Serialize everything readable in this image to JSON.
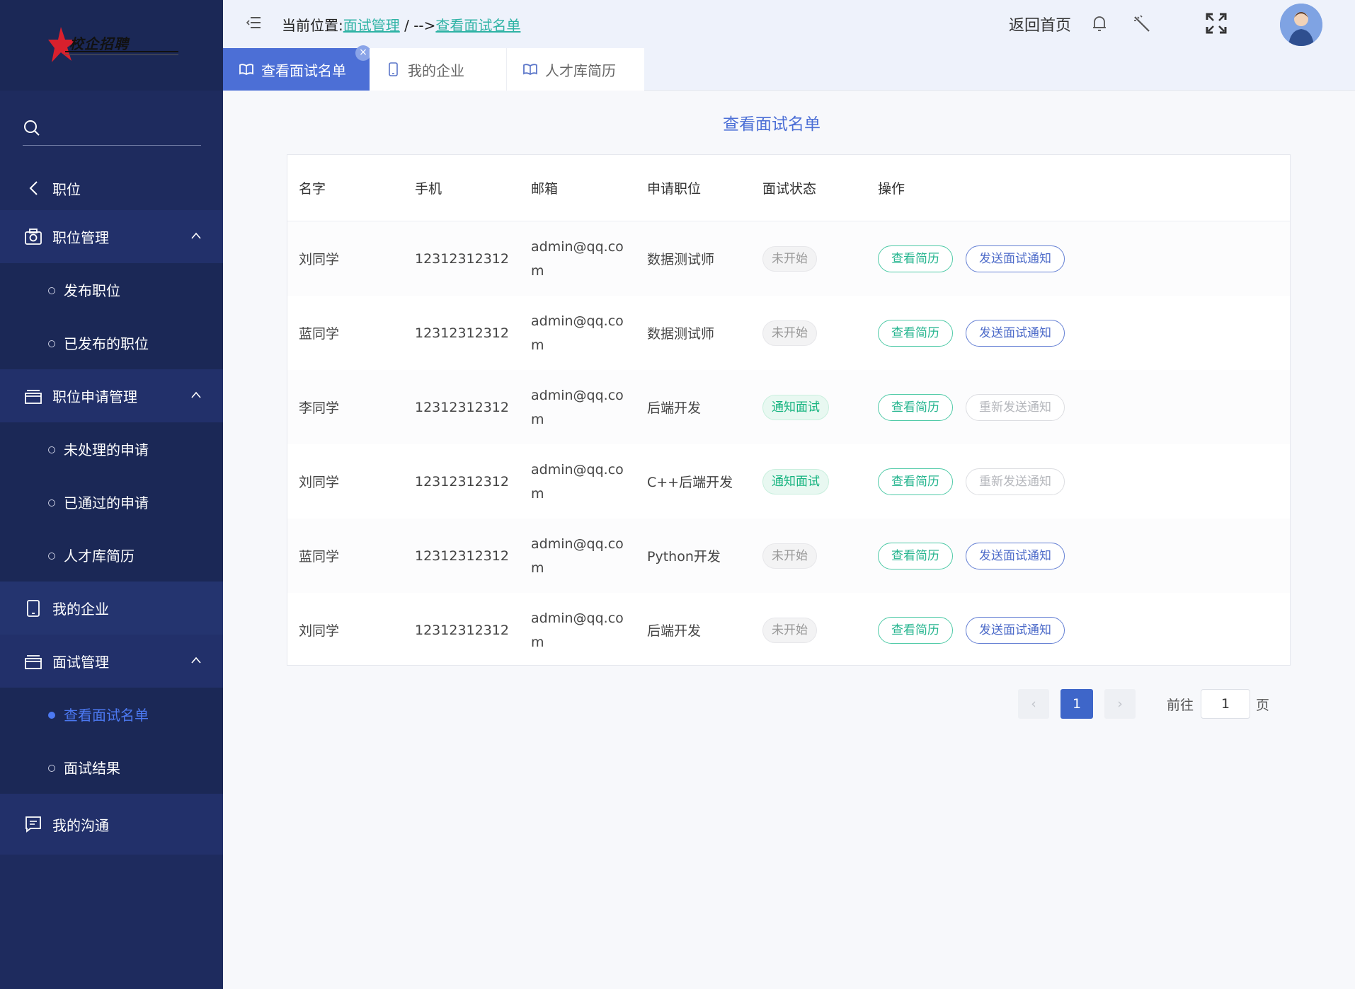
{
  "logo": {
    "text": "校企招聘"
  },
  "sidebar": {
    "search_placeholder": "",
    "back_label": "职位",
    "groups": [
      {
        "label": "职位管理",
        "items": [
          "发布职位",
          "已发布的职位"
        ]
      },
      {
        "label": "职位申请管理",
        "items": [
          "未处理的申请",
          "已通过的申请",
          "人才库简历"
        ]
      },
      {
        "label": "我的企业"
      },
      {
        "label": "面试管理",
        "items": [
          "查看面试名单",
          "面试结果"
        ]
      },
      {
        "label": "我的沟通"
      }
    ],
    "active_item": "查看面试名单"
  },
  "header": {
    "breadcrumb_prefix": "当前位置:",
    "breadcrumb_1": "面试管理",
    "breadcrumb_sep": " / -->",
    "breadcrumb_2": "查看面试名单",
    "home_label": "返回首页"
  },
  "tabs": [
    {
      "label": "查看面试名单",
      "active": true,
      "close": "×"
    },
    {
      "label": "我的企业"
    },
    {
      "label": "人才库简历"
    }
  ],
  "main": {
    "title": "查看面试名单",
    "columns": [
      "名字",
      "手机",
      "邮箱",
      "申请职位",
      "面试状态",
      "操作"
    ],
    "rows": [
      {
        "name": "刘同学",
        "phone": "12312312312",
        "email": "admin@qq.com",
        "position": "数据测试师",
        "status": "未开始",
        "status_color": "grey",
        "action1": "查看简历",
        "action2": "发送面试通知",
        "action2_state": "blue"
      },
      {
        "name": "蓝同学",
        "phone": "12312312312",
        "email": "admin@qq.com",
        "position": "数据测试师",
        "status": "未开始",
        "status_color": "grey",
        "action1": "查看简历",
        "action2": "发送面试通知",
        "action2_state": "blue"
      },
      {
        "name": "李同学",
        "phone": "12312312312",
        "email": "admin@qq.com",
        "position": "后端开发",
        "status": "通知面试",
        "status_color": "green",
        "action1": "查看简历",
        "action2": "重新发送通知",
        "action2_state": "disabled"
      },
      {
        "name": "刘同学",
        "phone": "12312312312",
        "email": "admin@qq.com",
        "position": "C++后端开发",
        "status": "通知面试",
        "status_color": "green",
        "action1": "查看简历",
        "action2": "重新发送通知",
        "action2_state": "disabled"
      },
      {
        "name": "蓝同学",
        "phone": "12312312312",
        "email": "admin@qq.com",
        "position": "Python开发",
        "status": "未开始",
        "status_color": "grey",
        "action1": "查看简历",
        "action2": "发送面试通知",
        "action2_state": "blue"
      },
      {
        "name": "刘同学",
        "phone": "12312312312",
        "email": "admin@qq.com",
        "position": "后端开发",
        "status": "未开始",
        "status_color": "grey",
        "action1": "查看简历",
        "action2": "发送面试通知",
        "action2_state": "blue"
      }
    ]
  },
  "pagination": {
    "prev": "‹",
    "current_page": "1",
    "next": "›",
    "goto_label": "前往",
    "goto_value": "1",
    "goto_suffix": "页"
  },
  "colors": {
    "sidebar_bg": "#1e2b5e",
    "accent": "#4c6fd6",
    "link": "#2fb3a5",
    "green": "#26b58f"
  }
}
